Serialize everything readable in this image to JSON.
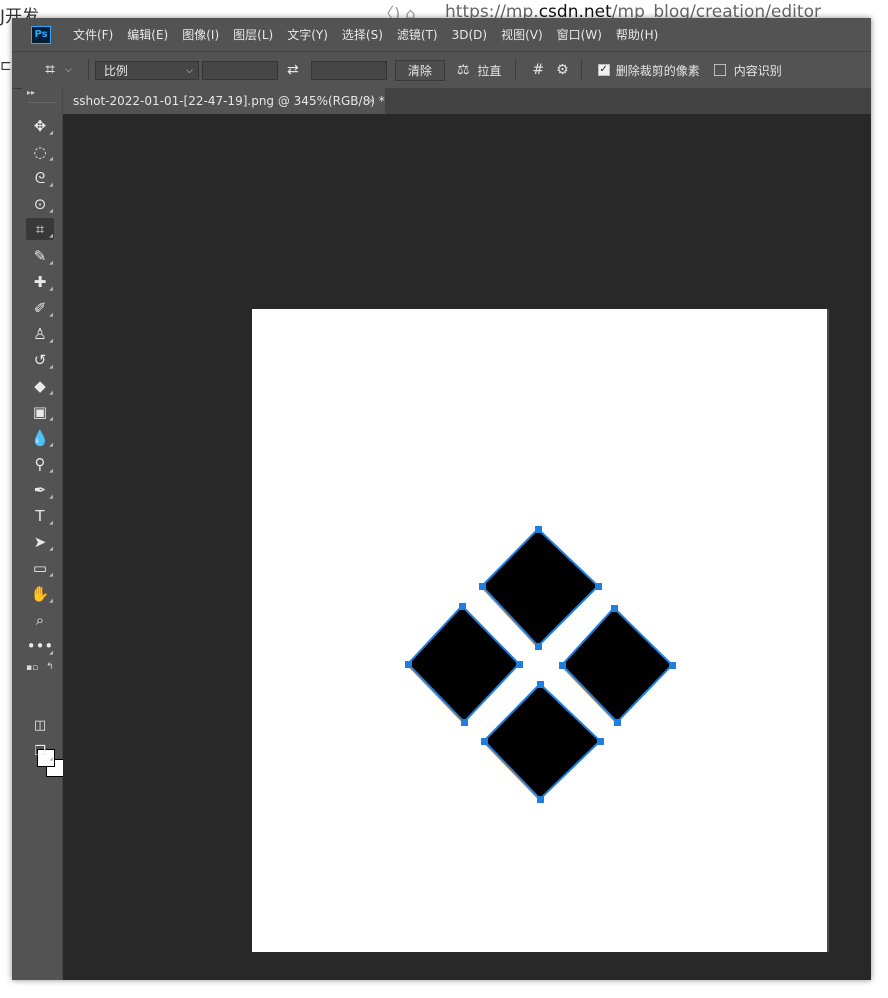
{
  "background": {
    "left_text": "J开发",
    "url_prefix": "https://mp.",
    "url_domain": "csdn.net",
    "url_path": "/mp_blog/creation/editor"
  },
  "app": {
    "logo_text": "Ps",
    "menu": [
      "文件(F)",
      "编辑(E)",
      "图像(I)",
      "图层(L)",
      "文字(Y)",
      "选择(S)",
      "滤镜(T)",
      "3D(D)",
      "视图(V)",
      "窗口(W)",
      "帮助(H)"
    ]
  },
  "options": {
    "ratio_select": "比例",
    "width_value": "",
    "height_value": "",
    "clear_button": "清除",
    "straighten_label": "拉直",
    "delete_cropped_label": "删除裁剪的像素",
    "delete_cropped_checked": true,
    "content_aware_label": "内容识别",
    "content_aware_checked": false
  },
  "document": {
    "tab_title": "sshot-2022-01-01-[22-47-19].png @ 345%(RGB/8) *",
    "close_glyph": "×"
  },
  "tools": [
    "move",
    "marquee",
    "lasso",
    "quick-select",
    "crop",
    "eyedropper",
    "healing",
    "brush",
    "stamp",
    "history-brush",
    "eraser",
    "gradient",
    "blur",
    "dodge",
    "pen",
    "type",
    "path-select",
    "rectangle",
    "hand",
    "zoom",
    "more"
  ],
  "colors": {
    "fg": "#ffffff",
    "bg": "#ffffff",
    "selection": "#1f7fe0"
  }
}
